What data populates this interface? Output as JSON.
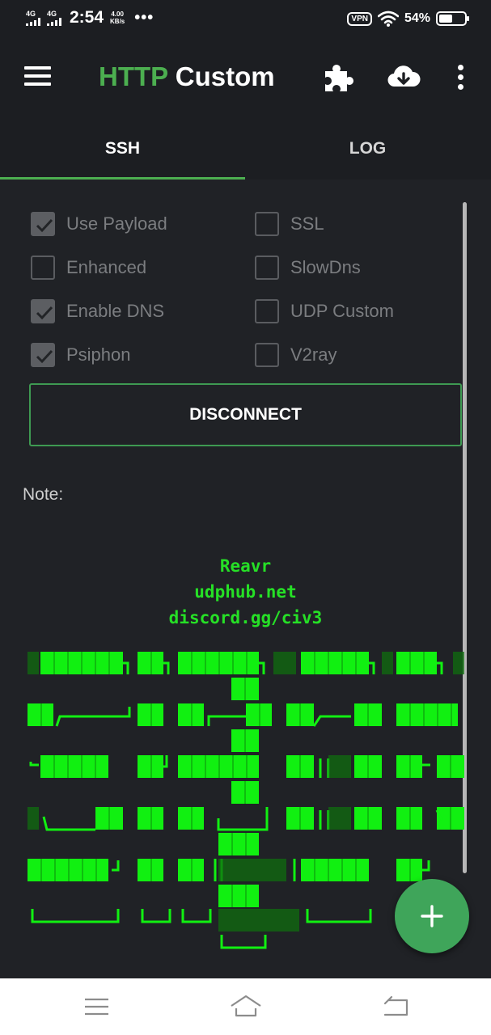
{
  "status_bar": {
    "network_1": "4G",
    "network_2": "4G",
    "time": "2:54",
    "speed_value": "4.00",
    "speed_unit": "KB/s",
    "more_dots": "•••",
    "vpn": "VPN",
    "battery_percent": "54%",
    "battery_level": 0.54
  },
  "app_bar": {
    "title_accent": "HTTP",
    "title_rest": " Custom",
    "menu_icon": "hamburger-menu-icon",
    "plugin_icon": "puzzle-icon",
    "download_icon": "cloud-download-icon",
    "more_icon": "more-vert-icon"
  },
  "tabs": [
    {
      "label": "SSH",
      "active": true
    },
    {
      "label": "LOG",
      "active": false
    }
  ],
  "options": {
    "left": [
      {
        "label": "Use Payload",
        "checked": true
      },
      {
        "label": "Enhanced",
        "checked": false
      },
      {
        "label": "Enable DNS",
        "checked": true
      },
      {
        "label": "Psiphon",
        "checked": true
      }
    ],
    "right": [
      {
        "label": "SSL",
        "checked": false
      },
      {
        "label": "SlowDns",
        "checked": false
      },
      {
        "label": "UDP Custom",
        "checked": false
      },
      {
        "label": "V2ray",
        "checked": false
      }
    ]
  },
  "disconnect_label": "DISCONNECT",
  "note": {
    "label": "Note:",
    "lines": [
      "Reavr",
      "udphub.net",
      "discord.gg/civ3"
    ]
  },
  "colors": {
    "accent": "#4caf50",
    "note_text": "#26e026",
    "banner_green": "#11f011",
    "background": "#202226"
  },
  "fab_icon": "plus-icon",
  "nav": {
    "menu_icon": "recents-menu-icon",
    "home_icon": "home-icon",
    "back_icon": "back-icon"
  }
}
